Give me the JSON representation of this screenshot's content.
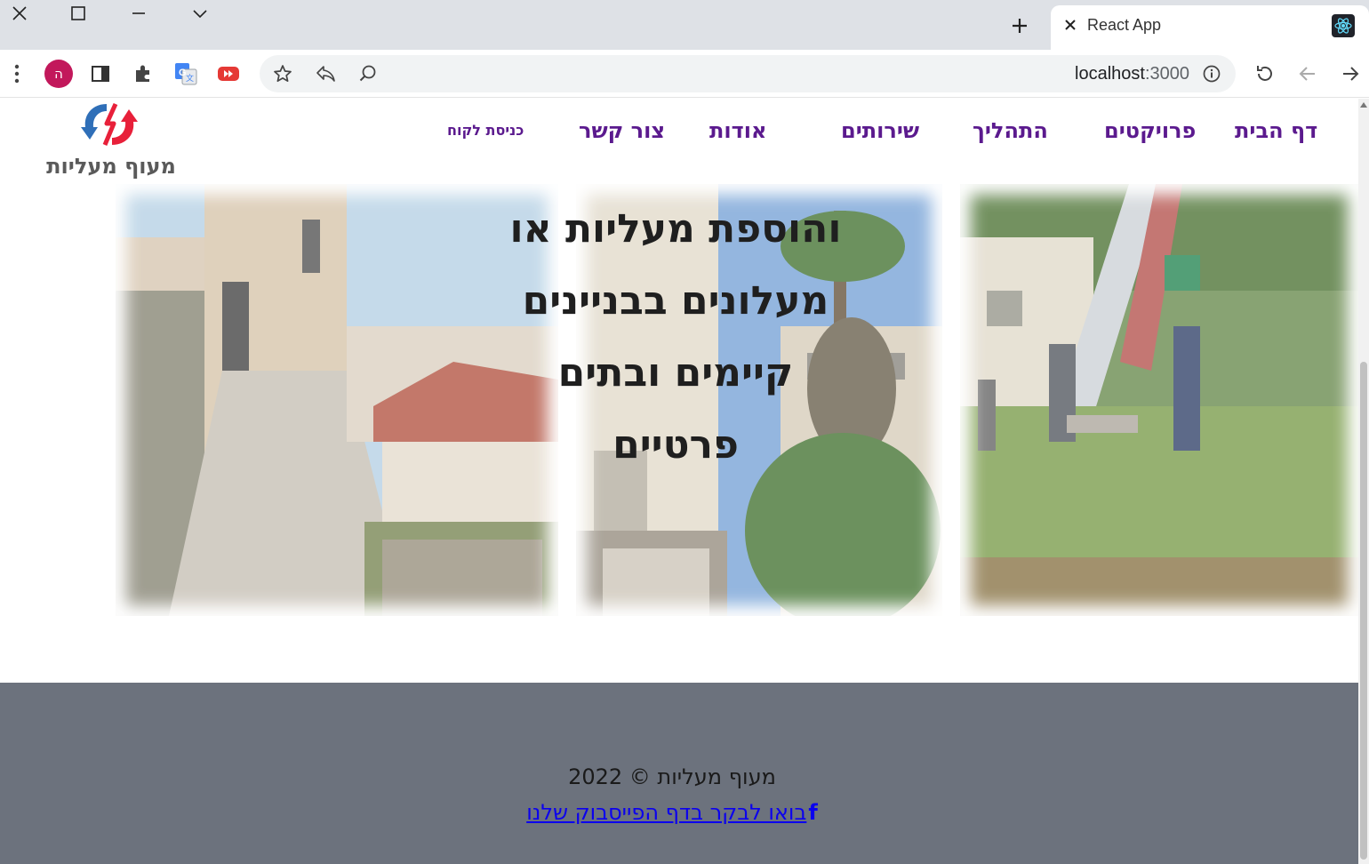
{
  "browser": {
    "tab_title": "React App",
    "url_host": "localhost",
    "url_port": ":3000",
    "avatar_letter": "ה",
    "window_buttons": [
      "close-icon",
      "maximize-icon",
      "minimize-icon",
      "chevron-down-icon"
    ]
  },
  "header": {
    "logo_text": "מעוף מעליות",
    "nav": {
      "home": "דף הבית",
      "projects": "פרויקטים",
      "process": "התהליך",
      "services": "שירותים",
      "about": "אודות",
      "contact": "צור קשר",
      "client_login": "כניסת לקוח"
    }
  },
  "hero": {
    "lines": [
      "והוספת מעליות או",
      "מעלונים בבניינים",
      "קיימים ובתים",
      "פרטיים"
    ]
  },
  "footer": {
    "copyright": "מעוף מעליות © 2022",
    "facebook_link": "בואו לבקר בדף הפייסבוק שלנו",
    "facebook_icon": "f"
  },
  "colors": {
    "nav": "#5b1a8e",
    "footer_bg": "#6c727d",
    "link": "#0b00ee",
    "logo_red": "#e8203a",
    "logo_blue": "#2f6fb8"
  }
}
